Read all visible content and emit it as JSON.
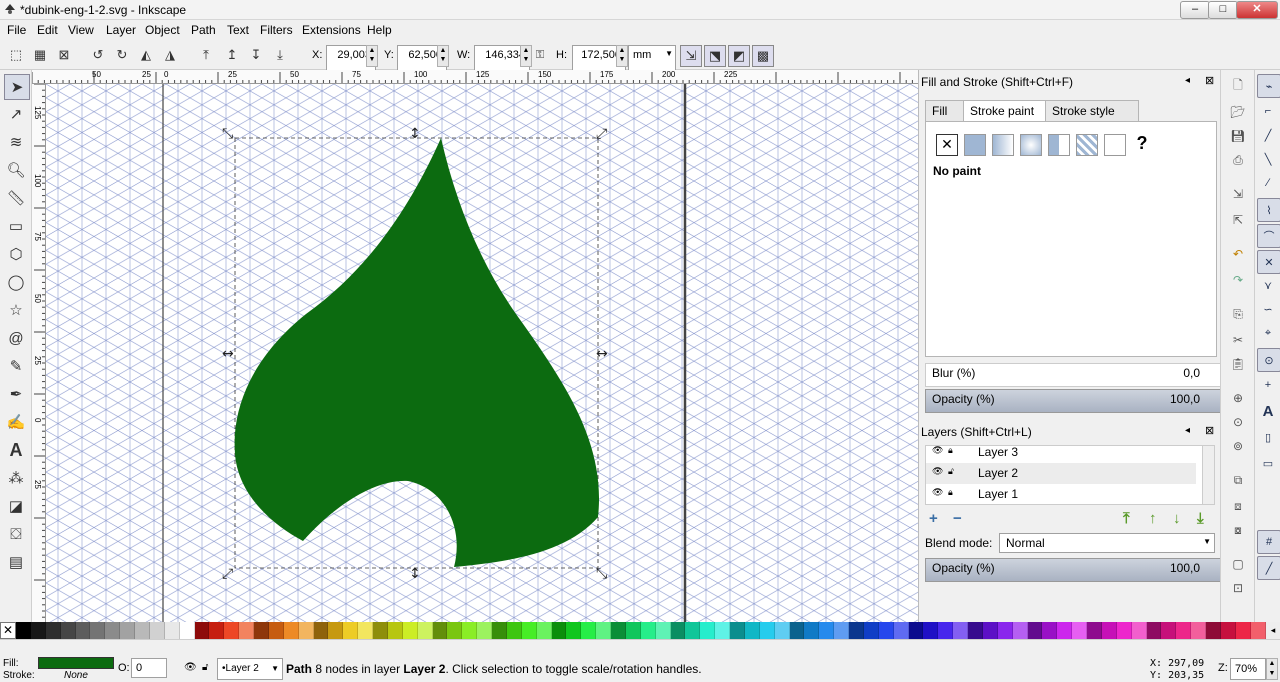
{
  "window": {
    "title": "*dubink-eng-1-2.svg - Inkscape",
    "min": "–",
    "max": "□",
    "close": "✕"
  },
  "menu": [
    "File",
    "Edit",
    "View",
    "Layer",
    "Object",
    "Path",
    "Text",
    "Filters",
    "Extensions",
    "Help"
  ],
  "toolbar": {
    "x_label": "X:",
    "x_value": "29,003",
    "y_label": "Y:",
    "y_value": "62,500",
    "w_label": "W:",
    "w_value": "146,334",
    "h_label": "H:",
    "h_value": "172,500",
    "unit": "mm"
  },
  "hruler_ticks": [
    "50",
    "25",
    "0",
    "25",
    "50",
    "75",
    "100",
    "125",
    "150",
    "175",
    "200",
    "225"
  ],
  "vruler_ticks": [
    "125",
    "100",
    "75",
    "50",
    "25",
    "0",
    "25"
  ],
  "fill_stroke": {
    "title": "Fill and Stroke (Shift+Ctrl+F)",
    "tabs": [
      "Fill",
      "Stroke paint",
      "Stroke style"
    ],
    "paint_status": "No paint",
    "help_glyph": "?",
    "blur_label": "Blur (%)",
    "blur_value": "0,0",
    "opacity_label": "Opacity (%)",
    "opacity_value": "100,0"
  },
  "layers": {
    "title": "Layers (Shift+Ctrl+L)",
    "items": [
      "Layer 3",
      "Layer 2",
      "Layer 1"
    ],
    "blend_label": "Blend mode:",
    "blend_value": "Normal",
    "opacity_label": "Opacity (%)",
    "opacity_value": "100,0"
  },
  "status": {
    "fill_label": "Fill:",
    "stroke_label": "Stroke:",
    "stroke_value": "None",
    "fill_color": "#0c6b10",
    "opacity_label": "O:",
    "opacity_value": "0",
    "layer": "•Layer 2",
    "message_bold": "Path",
    "message_rest": " 8 nodes in layer ",
    "message_layer": "Layer 2",
    "message_tail": ". Click selection to toggle scale/rotation handles.",
    "x_label": "X:",
    "x_value": "297,09",
    "y_label": "Y:",
    "y_value": "203,35",
    "z_label": "Z:",
    "zoom": "70%"
  },
  "colors": {
    "leaf": "#0c6b10",
    "accent": "#3a6ea5",
    "grid": "#8e9cd0"
  }
}
